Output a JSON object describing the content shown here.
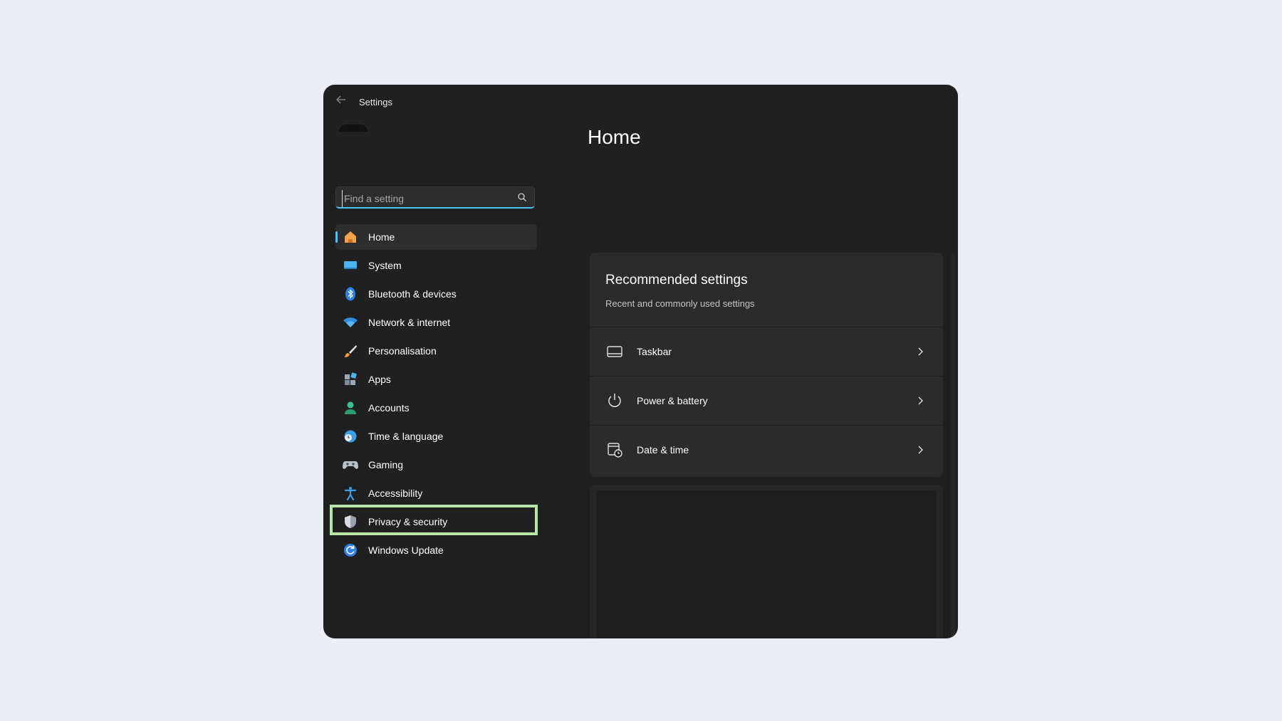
{
  "app": {
    "title": "Settings"
  },
  "search": {
    "placeholder": "Find a setting"
  },
  "nav": {
    "items": [
      {
        "label": "Home",
        "icon": "home-icon",
        "active": true
      },
      {
        "label": "System",
        "icon": "system-icon"
      },
      {
        "label": "Bluetooth & devices",
        "icon": "bluetooth-icon"
      },
      {
        "label": "Network & internet",
        "icon": "wifi-icon"
      },
      {
        "label": "Personalisation",
        "icon": "brush-icon"
      },
      {
        "label": "Apps",
        "icon": "apps-icon"
      },
      {
        "label": "Accounts",
        "icon": "person-icon"
      },
      {
        "label": "Time & language",
        "icon": "globe-clock-icon"
      },
      {
        "label": "Gaming",
        "icon": "gamepad-icon"
      },
      {
        "label": "Accessibility",
        "icon": "accessibility-icon"
      },
      {
        "label": "Privacy & security",
        "icon": "shield-icon",
        "highlighted": true
      },
      {
        "label": "Windows Update",
        "icon": "update-icon"
      }
    ]
  },
  "main": {
    "title": "Home",
    "recommended": {
      "title": "Recommended settings",
      "subtitle": "Recent and commonly used settings",
      "rows": [
        {
          "label": "Taskbar",
          "icon": "taskbar-icon"
        },
        {
          "label": "Power & battery",
          "icon": "power-icon"
        },
        {
          "label": "Date & time",
          "icon": "calendar-clock-icon"
        }
      ]
    }
  },
  "colors": {
    "accent": "#4cc2ff",
    "highlight": "#b8e6a6",
    "window_bg": "#202020",
    "card_bg": "#2b2b2b"
  }
}
